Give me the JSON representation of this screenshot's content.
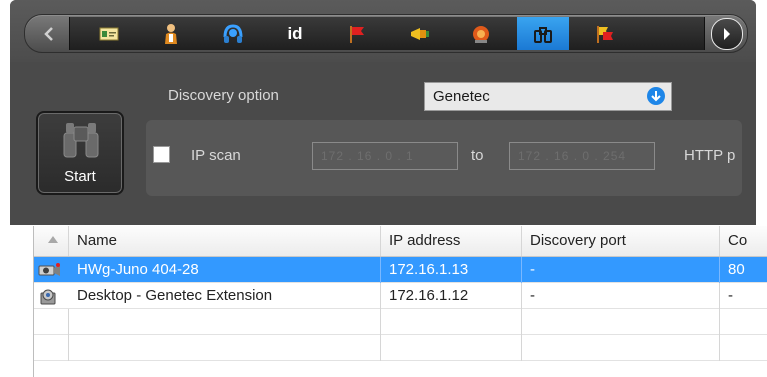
{
  "colors": {
    "panel": "#4a4a4a",
    "accent": "#1e86e8",
    "selection": "#3399ff"
  },
  "toolbar": {
    "icons": [
      "id-card-icon",
      "person-icon",
      "headset-icon",
      "id-icon",
      "flag-icon",
      "megaphone-icon",
      "alarm-icon",
      "binoculars-icon",
      "flags-icon"
    ],
    "id_text": "id",
    "active_index": 7
  },
  "discovery": {
    "label": "Discovery option",
    "selected": "Genetec"
  },
  "start_label": "Start",
  "scan": {
    "ip_scan_label": "IP scan",
    "checked": false,
    "from_value": "172 . 16 . 0 . 1",
    "to_label": "to",
    "to_value": "172 . 16 . 0 . 254",
    "http_label": "HTTP p"
  },
  "table": {
    "columns": [
      "Name",
      "IP address",
      "Discovery port",
      "Co"
    ],
    "rows": [
      {
        "icon": "camera-icon",
        "name": "HWg-Juno 404-28",
        "ip": "172.16.1.13",
        "port": "-",
        "extra": "80",
        "selected": true
      },
      {
        "icon": "extension-icon",
        "name": "Desktop - Genetec Extension",
        "ip": "172.16.1.12",
        "port": "-",
        "extra": "-",
        "selected": false
      }
    ]
  }
}
